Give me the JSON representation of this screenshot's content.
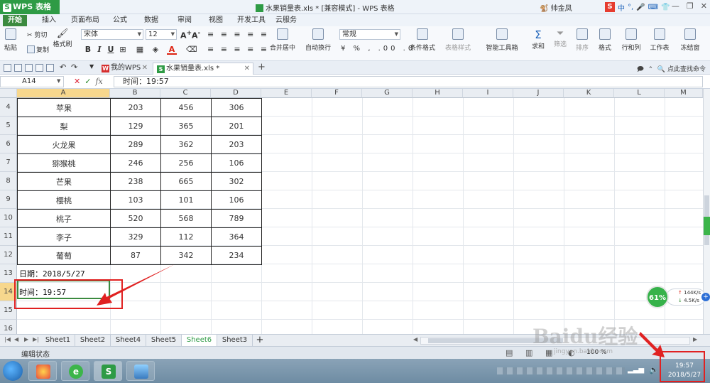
{
  "titlebar": {
    "app_name": "WPS 表格",
    "app_logo": "S",
    "doc_title": "水果销量表.xls * [兼容模式] - WPS 表格",
    "user": "帅金凤"
  },
  "menu": {
    "tabs": [
      "开始",
      "插入",
      "页面布局",
      "公式",
      "数据",
      "审阅",
      "视图",
      "开发工具",
      "云服务"
    ],
    "active": "开始"
  },
  "ribbon": {
    "paste": "粘贴",
    "cut": "剪切",
    "copy": "复制",
    "format_painter": "格式刷",
    "font_name": "宋体",
    "font_size": "12",
    "merge_center": "合并居中",
    "wrap_text": "自动换行",
    "number_format": "常规",
    "conditional_format": "条件格式",
    "table_style": "表格样式",
    "smart_toolbox": "智能工具箱",
    "sum": "求和",
    "filter": "筛选",
    "sort": "排序",
    "format": "格式",
    "rows_cols": "行和列",
    "worksheet": "工作表",
    "freeze": "冻结窗"
  },
  "doctabs": {
    "my_wps": "我的WPS",
    "file": "水果销量表.xls *",
    "search_hint": "点此查找命令"
  },
  "formula_bar": {
    "cell_ref": "A14",
    "fx": "fx",
    "content": "时间：19:57"
  },
  "grid": {
    "columns": [
      "A",
      "B",
      "C",
      "D",
      "E",
      "F",
      "G",
      "H",
      "I",
      "J",
      "K",
      "L",
      "M"
    ],
    "row_numbers": [
      "4",
      "5",
      "6",
      "7",
      "8",
      "9",
      "10",
      "11",
      "12",
      "13",
      "14",
      "15",
      "16"
    ],
    "rows": [
      {
        "name": "苹果",
        "b": "203",
        "c": "456",
        "d": "306"
      },
      {
        "name": "梨",
        "b": "129",
        "c": "365",
        "d": "201"
      },
      {
        "name": "火龙果",
        "b": "289",
        "c": "362",
        "d": "203"
      },
      {
        "name": "猕猴桃",
        "b": "246",
        "c": "256",
        "d": "106"
      },
      {
        "name": "芒果",
        "b": "238",
        "c": "665",
        "d": "302"
      },
      {
        "name": "樱桃",
        "b": "103",
        "c": "101",
        "d": "106"
      },
      {
        "name": "桃子",
        "b": "520",
        "c": "568",
        "d": "789"
      },
      {
        "name": "李子",
        "b": "329",
        "c": "112",
        "d": "364"
      },
      {
        "name": "葡萄",
        "b": "87",
        "c": "342",
        "d": "234"
      }
    ],
    "date_note": "日期：2018/5/27",
    "time_note": "时间：19:57"
  },
  "sheets": {
    "tabs": [
      "Sheet1",
      "Sheet2",
      "Sheet4",
      "Sheet5",
      "Sheet6",
      "Sheet3"
    ],
    "active": "Sheet6",
    "add": "+"
  },
  "status": {
    "mode": "编辑状态",
    "zoom": "100 %"
  },
  "speed_widget": {
    "percent": "61%",
    "up": "144K/s",
    "down": "4.5K/s"
  },
  "taskbar": {
    "time": "19:57",
    "date": "2018/5/27"
  },
  "watermark": {
    "brand": "Baidu经验",
    "url": "jingyan.baidu.com"
  },
  "colors": {
    "wps_green": "#2e9b45",
    "selection_header": "#f7d78d",
    "annotation_red": "#e02121"
  }
}
